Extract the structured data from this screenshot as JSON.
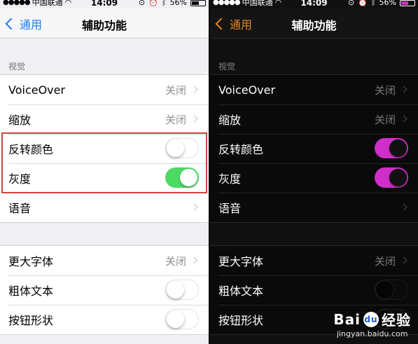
{
  "status": {
    "carrier": "中国联通",
    "time": "14:09",
    "battery": "56%"
  },
  "nav": {
    "back_label": "通用",
    "title": "辅助功能"
  },
  "section_vision": "视觉",
  "rows": {
    "voiceover": {
      "label": "VoiceOver",
      "value": "关闭"
    },
    "zoom": {
      "label": "缩放",
      "value": "关闭"
    },
    "invert_colors": {
      "label": "反转颜色"
    },
    "grayscale": {
      "label": "灰度"
    },
    "speech": {
      "label": "语音"
    },
    "larger_text": {
      "label": "更大字体",
      "value": "关闭"
    },
    "bold_text": {
      "label": "粗体文本"
    },
    "button_shapes": {
      "label": "按钮形状"
    }
  },
  "light_toggles": {
    "invert_colors": "off",
    "grayscale": "on",
    "bold_text": "off",
    "button_shapes": "off"
  },
  "dark_toggles": {
    "invert_colors": "on",
    "grayscale": "on",
    "bold_text": "off",
    "button_shapes": "off"
  },
  "colors": {
    "light_accent": "#1a7cf0",
    "light_toggle_on": "#4cd964",
    "dark_accent": "#e8842a",
    "dark_toggle_on": "#d02ec8",
    "highlight_border": "#d0453e"
  },
  "watermark": {
    "brand": "Bai",
    "brand_suffix": "经验",
    "url": "jingyan.baidu.com"
  }
}
